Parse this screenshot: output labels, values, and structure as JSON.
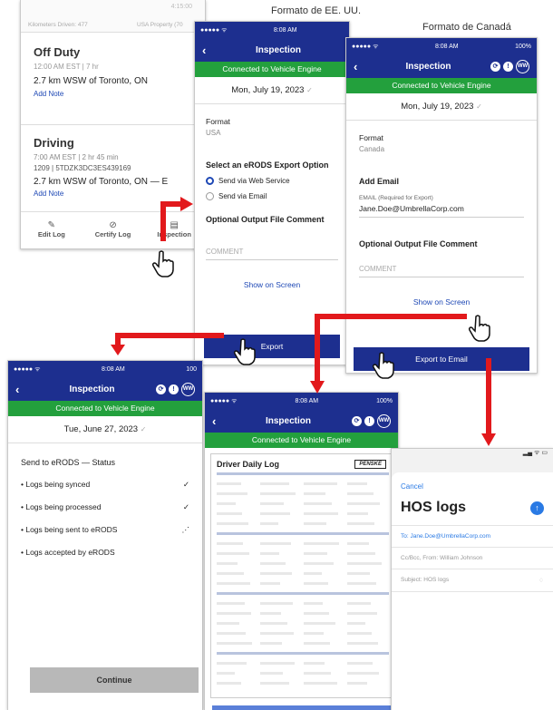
{
  "captions": {
    "usa": "Formato de EE. UU.",
    "canada": "Formato de Canadá"
  },
  "log": {
    "top": {
      "km": "Kilometers Driven: 477",
      "property": "USA Property (70",
      "time": "4:15:00"
    },
    "off": {
      "status": "Off Duty",
      "time": "12:00 AM EST | 7 hr",
      "loc": "2.7 km WSW of Toronto, ON",
      "note": "Add Note"
    },
    "driving": {
      "status": "Driving",
      "time": "7:00 AM EST | 2 hr 45 min",
      "vin": "1209 | 5TDZK3DC3ES439169",
      "loc": "2.7 km WSW of Toronto, ON — E",
      "note": "Add Note"
    },
    "tabs": [
      {
        "label": "Edit Log",
        "icon": "pencil-icon"
      },
      {
        "label": "Certify Log",
        "icon": "check-circle-icon"
      },
      {
        "label": "Inspection",
        "icon": "clipboard-icon"
      }
    ]
  },
  "usa": {
    "status_time": "8:08 AM",
    "title": "Inspection",
    "banner": "Connected to Vehicle Engine",
    "date": "Mon, July 19, 2023",
    "format_label": "Format",
    "format_value": "USA",
    "select_label": "Select an eRODS Export Option",
    "opt1": "Send via Web Service",
    "opt2": "Send via Email",
    "comment_label": "Optional Output File Comment",
    "comment_placeholder": "COMMENT",
    "show": "Show on Screen",
    "export": "Export"
  },
  "canada": {
    "status_time": "8:08 AM",
    "battery": "100%",
    "title": "Inspection",
    "banner": "Connected to Vehicle Engine",
    "date": "Mon, July 19, 2023",
    "format_label": "Format",
    "format_value": "Canada",
    "add_email": "Add Email",
    "email_label": "EMAIL (Required for Export)",
    "email_value": "Jane.Doe@UmbrellaCorp.com",
    "comment_label": "Optional Output File Comment",
    "comment_placeholder": "COMMENT",
    "show": "Show on Screen",
    "export": "Export to Email"
  },
  "status": {
    "status_time": "8:08 AM",
    "battery": "100",
    "title": "Inspection",
    "banner": "Connected to Vehicle Engine",
    "date": "Tue, June 27, 2023",
    "heading": "Send to eRODS — Status",
    "items": [
      {
        "label": "Logs being synced",
        "mark": "✓"
      },
      {
        "label": "Logs being processed",
        "mark": "✓"
      },
      {
        "label": "Logs being sent to eRODS",
        "mark": "⋰"
      },
      {
        "label": "Logs accepted by eRODS",
        "mark": ""
      }
    ],
    "continue": "Continue"
  },
  "report": {
    "status_time": "8:08 AM",
    "battery": "100%",
    "title": "Inspection",
    "banner": "Connected to Vehicle Engine",
    "doc_title": "Driver Daily Log",
    "brand": "PENSKE"
  },
  "email": {
    "cancel": "Cancel",
    "subject_title": "HOS logs",
    "to": "To: Jane.Doe@UmbrellaCorp.com",
    "cc": "Cc/Bcc, From: William Johnson",
    "subject": "Subject: HOS logs"
  }
}
